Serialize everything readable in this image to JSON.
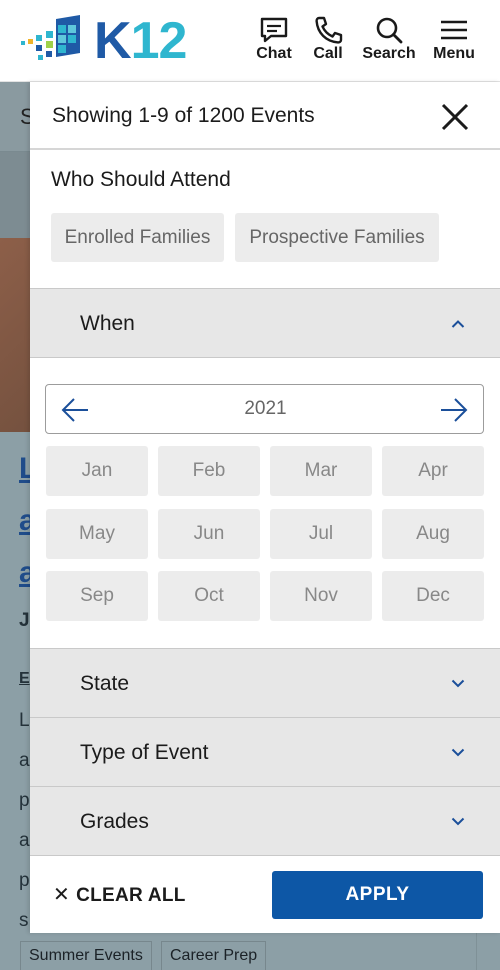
{
  "header": {
    "logo_text_k": "K",
    "logo_text_num": "12",
    "nav": {
      "chat": "Chat",
      "call": "Call",
      "search": "Search",
      "menu": "Menu"
    }
  },
  "background": {
    "subbar_letter": "S",
    "letters": [
      "L",
      "a",
      "a"
    ],
    "small_lines": [
      "Ju",
      "E",
      "L",
      "a",
      "p",
      "a",
      "p",
      "s"
    ],
    "tags": [
      "Summer Events",
      "Career Prep"
    ]
  },
  "drawer": {
    "title": "Showing 1-9 of 1200 Events",
    "who_title": "Who Should Attend",
    "chips": [
      "Enrolled Families",
      "Prospective Families"
    ],
    "when_label": "When",
    "year": "2021",
    "months": [
      "Jan",
      "Feb",
      "Mar",
      "Apr",
      "May",
      "Jun",
      "Jul",
      "Aug",
      "Sep",
      "Oct",
      "Nov",
      "Dec"
    ],
    "state_label": "State",
    "type_label": "Type of Event",
    "grades_label": "Grades",
    "clear_all": "CLEAR ALL",
    "apply": "APPLY"
  },
  "colors": {
    "brand_blue": "#1f5aa6",
    "brand_teal": "#2fb6cf",
    "apply_bg": "#0d57a6",
    "accordion_bg": "#e7e7e7",
    "chip_bg": "#ececec"
  }
}
